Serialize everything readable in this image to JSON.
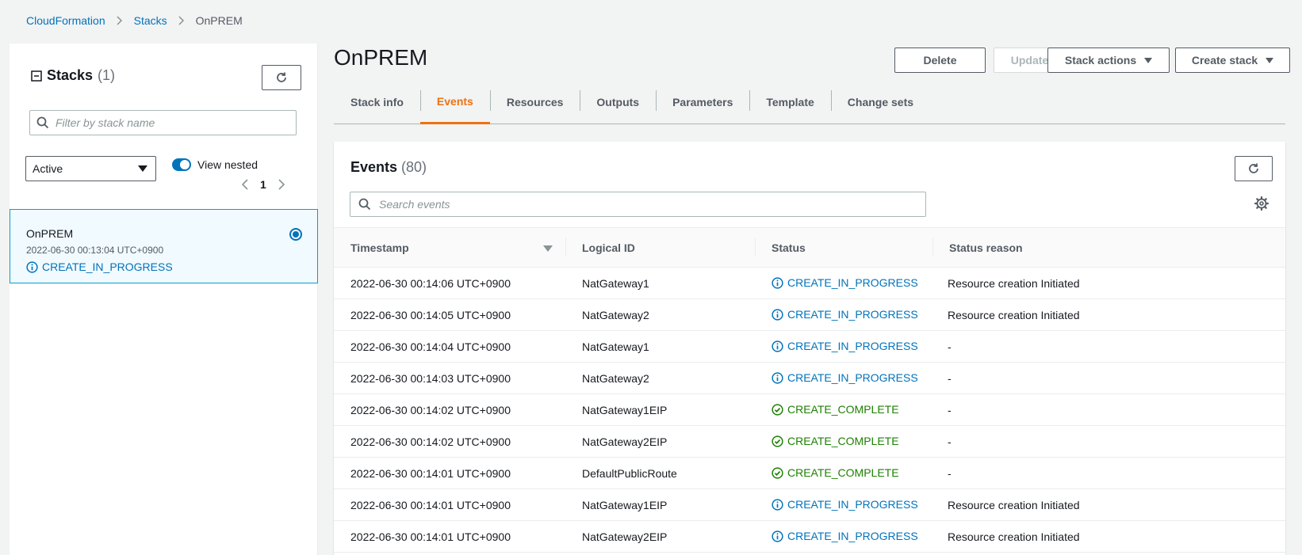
{
  "breadcrumb": {
    "items": [
      "CloudFormation",
      "Stacks"
    ],
    "current": "OnPREM"
  },
  "sidebar": {
    "title": "Stacks",
    "count": "(1)",
    "filter_placeholder": "Filter by stack name",
    "status_filter": "Active",
    "view_nested_label": "View nested",
    "page": "1",
    "stack": {
      "name": "OnPREM",
      "timestamp": "2022-06-30 00:13:04 UTC+0900",
      "status": "CREATE_IN_PROGRESS"
    }
  },
  "header": {
    "title": "OnPREM",
    "delete_label": "Delete",
    "update_label": "Update",
    "stack_actions_label": "Stack actions",
    "create_stack_label": "Create stack"
  },
  "tabs": [
    "Stack info",
    "Events",
    "Resources",
    "Outputs",
    "Parameters",
    "Template",
    "Change sets"
  ],
  "events": {
    "title": "Events",
    "count": "(80)",
    "search_placeholder": "Search events",
    "columns": [
      "Timestamp",
      "Logical ID",
      "Status",
      "Status reason"
    ],
    "rows": [
      {
        "timestamp": "2022-06-30 00:14:06 UTC+0900",
        "logical_id": "NatGateway1",
        "status": "CREATE_IN_PROGRESS",
        "reason": "Resource creation Initiated"
      },
      {
        "timestamp": "2022-06-30 00:14:05 UTC+0900",
        "logical_id": "NatGateway2",
        "status": "CREATE_IN_PROGRESS",
        "reason": "Resource creation Initiated"
      },
      {
        "timestamp": "2022-06-30 00:14:04 UTC+0900",
        "logical_id": "NatGateway1",
        "status": "CREATE_IN_PROGRESS",
        "reason": "-"
      },
      {
        "timestamp": "2022-06-30 00:14:03 UTC+0900",
        "logical_id": "NatGateway2",
        "status": "CREATE_IN_PROGRESS",
        "reason": "-"
      },
      {
        "timestamp": "2022-06-30 00:14:02 UTC+0900",
        "logical_id": "NatGateway1EIP",
        "status": "CREATE_COMPLETE",
        "reason": "-"
      },
      {
        "timestamp": "2022-06-30 00:14:02 UTC+0900",
        "logical_id": "NatGateway2EIP",
        "status": "CREATE_COMPLETE",
        "reason": "-"
      },
      {
        "timestamp": "2022-06-30 00:14:01 UTC+0900",
        "logical_id": "DefaultPublicRoute",
        "status": "CREATE_COMPLETE",
        "reason": "-"
      },
      {
        "timestamp": "2022-06-30 00:14:01 UTC+0900",
        "logical_id": "NatGateway1EIP",
        "status": "CREATE_IN_PROGRESS",
        "reason": "Resource creation Initiated"
      },
      {
        "timestamp": "2022-06-30 00:14:01 UTC+0900",
        "logical_id": "NatGateway2EIP",
        "status": "CREATE_IN_PROGRESS",
        "reason": "Resource creation Initiated"
      }
    ]
  },
  "colors": {
    "link": "#0073bb",
    "accent": "#ec7211",
    "success": "#1d8102",
    "background": "#f2f3f3"
  }
}
